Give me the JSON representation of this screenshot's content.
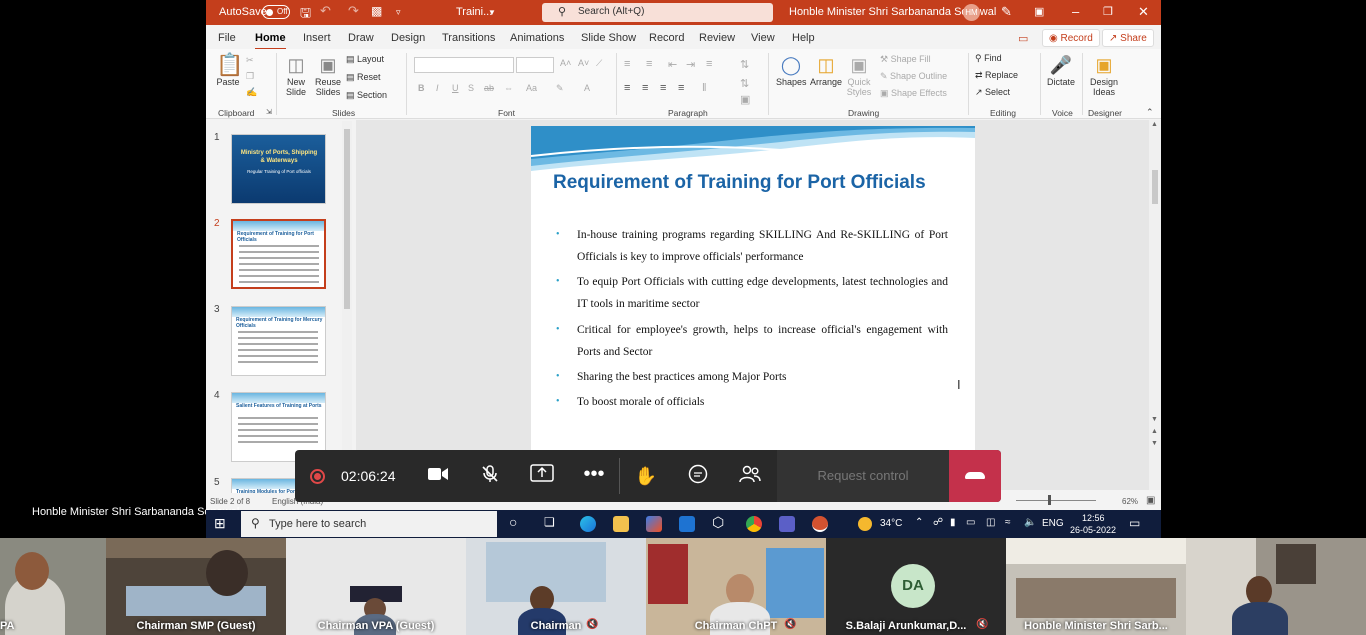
{
  "ppt": {
    "autosave_label": "AutoSave",
    "autosave_state": "Off",
    "file_name": "Traini...",
    "search_placeholder": "Search (Alt+Q)",
    "user_name": "Honble Minister Shri Sarbananda Sonowal",
    "user_initials": "HM",
    "menu": [
      "File",
      "Home",
      "Insert",
      "Draw",
      "Design",
      "Transitions",
      "Animations",
      "Slide Show",
      "Record",
      "Review",
      "View",
      "Help"
    ],
    "record_label": "Record",
    "share_label": "Share",
    "ribbon": {
      "paste": "Paste",
      "new_slide": "New Slide",
      "reuse_slides": "Reuse Slides",
      "layout": "Layout",
      "reset": "Reset",
      "section": "Section",
      "shapes": "Shapes",
      "arrange": "Arrange",
      "quick_styles": "Quick Styles",
      "shape_fill": "Shape Fill",
      "shape_outline": "Shape Outline",
      "shape_effects": "Shape Effects",
      "find": "Find",
      "replace": "Replace",
      "select": "Select",
      "dictate": "Dictate",
      "design_ideas": "Design Ideas",
      "groups": [
        "Clipboard",
        "Slides",
        "Font",
        "Paragraph",
        "Drawing",
        "Editing",
        "Voice",
        "Designer"
      ]
    },
    "thumb_numbers": [
      "1",
      "2",
      "3",
      "4",
      "5"
    ],
    "thumbs": [
      {
        "title": "Ministry of Ports, Shipping & Waterways",
        "subtitle": "Regular Training of Port officials"
      },
      {
        "title": "Requirement of Training for Port Officials"
      },
      {
        "title": "Requirement of Training for Mercury Officials"
      },
      {
        "title": "Salient Features of Training at Ports"
      },
      {
        "title": "Training Modules for Ports"
      }
    ],
    "slide": {
      "title": "Requirement of Training for Port Officials",
      "bullets": [
        "In-house training programs regarding SKILLING And Re-SKILLING of Port Officials is key to improve officials' performance",
        "To equip Port Officials with cutting edge developments, latest technologies and IT tools in maritime sector",
        " Critical for employee's growth, helps to increase official's engagement with Ports and Sector",
        "Sharing the best practices among Major Ports",
        " To boost morale of officials"
      ]
    },
    "status": {
      "slide_of": "Slide 2 of 8",
      "language": "English (India)",
      "zoom": "62%"
    }
  },
  "call": {
    "timer": "02:06:24",
    "request_control": "Request control",
    "presenter": "Honble Minister Shri Sarbananda Sonowal"
  },
  "taskbar": {
    "search_placeholder": "Type here to search",
    "temperature": "34°C",
    "lang": "ENG",
    "time": "12:56",
    "date": "26-05-2022"
  },
  "participants": [
    {
      "name": "PA"
    },
    {
      "name": "Chairman SMP (Guest)"
    },
    {
      "name": "Chairman VPA (Guest)"
    },
    {
      "name": "Chairman"
    },
    {
      "name": "Chairman ChPT"
    },
    {
      "name": "S.Balaji Arunkumar,D...",
      "initials": "DA"
    },
    {
      "name": "Honble Minister Shri Sarb..."
    }
  ]
}
